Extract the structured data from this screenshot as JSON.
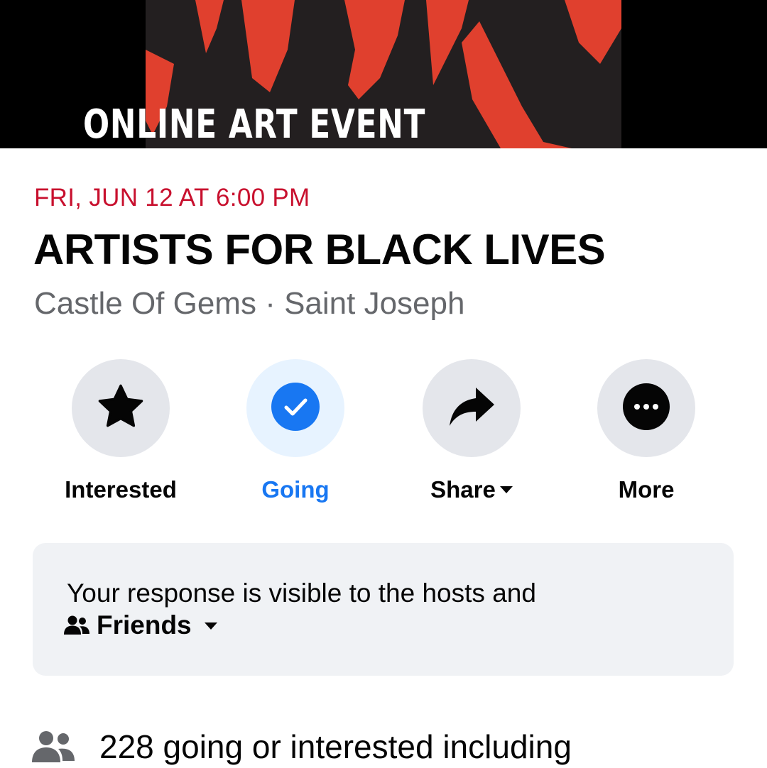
{
  "banner": {
    "text": "ONLINE ART EVENT",
    "colors": {
      "background": "#000000",
      "art": "#231f20",
      "accent": "#e0402e"
    }
  },
  "event": {
    "date": "FRI, JUN 12 AT 6:00 PM",
    "title": "ARTISTS FOR BLACK LIVES",
    "location": "Castle Of Gems · Saint Joseph"
  },
  "actions": [
    {
      "label": "Interested",
      "icon": "star-icon",
      "selected": false
    },
    {
      "label": "Going",
      "icon": "check-circle-icon",
      "selected": true
    },
    {
      "label": "Share",
      "icon": "share-arrow-icon",
      "selected": false
    },
    {
      "label": "More",
      "icon": "more-dots-icon",
      "selected": false
    }
  ],
  "privacy": {
    "text": "Your response is visible to the hosts and",
    "audience_label": "Friends",
    "audience_icon": "friends-icon"
  },
  "attendance": {
    "text": "228 going or interested including",
    "icon": "people-icon"
  },
  "colors": {
    "date": "#c8102e",
    "accent_blue": "#1877f2",
    "secondary_text": "#65676b",
    "button_bg": "#e4e6eb",
    "selected_bg": "#e7f3ff",
    "panel_bg": "#f0f2f5"
  }
}
